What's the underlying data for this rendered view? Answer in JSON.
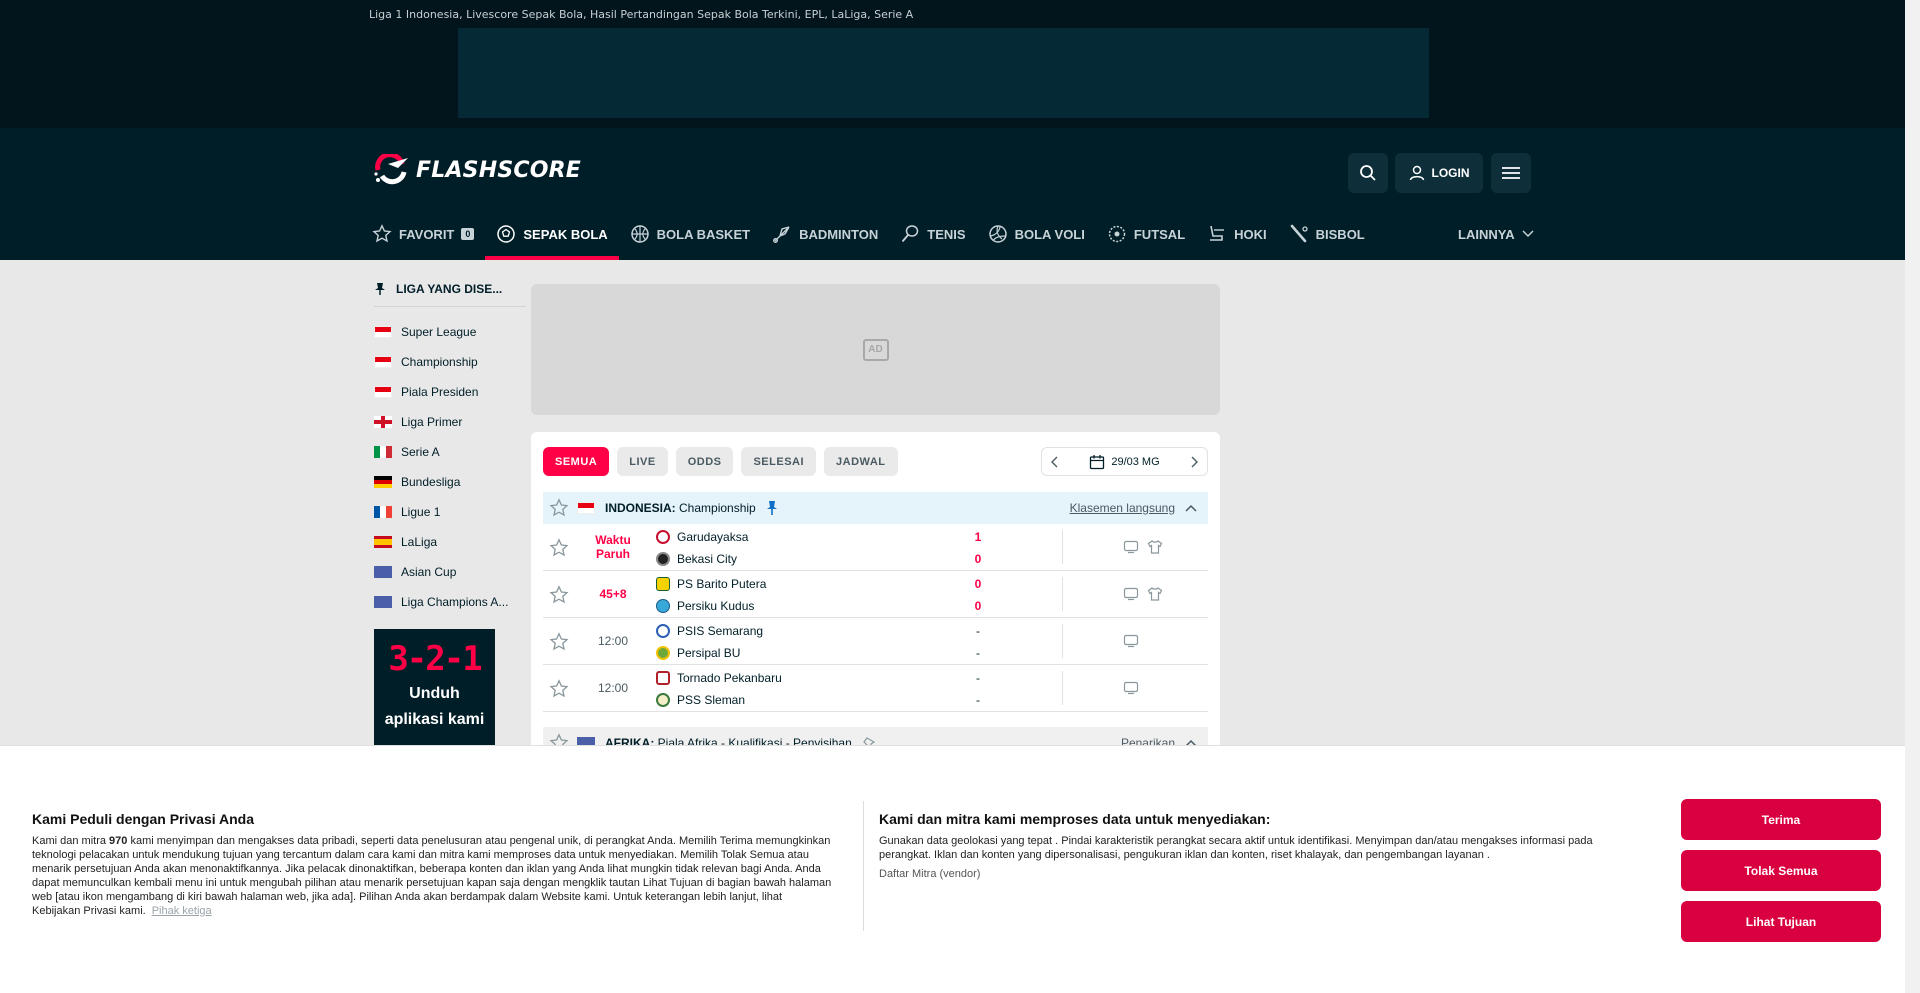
{
  "seo_title": "Liga 1 Indonesia, Livescore Sepak Bola, Hasil Pertandingan Sepak Bola Terkini, EPL, LaLiga, Serie A",
  "header": {
    "logo_text": "FLASHSCORE",
    "login_label": "LOGIN",
    "nav": [
      {
        "label": "FAVORIT",
        "icon": "star-icon",
        "badge": "0"
      },
      {
        "label": "SEPAK BOLA",
        "icon": "soccer-ball-icon"
      },
      {
        "label": "BOLA BASKET",
        "icon": "basketball-icon"
      },
      {
        "label": "BADMINTON",
        "icon": "shuttlecock-icon"
      },
      {
        "label": "TENIS",
        "icon": "tennis-racket-icon"
      },
      {
        "label": "BOLA VOLI",
        "icon": "volleyball-icon"
      },
      {
        "label": "FUTSAL",
        "icon": "futsal-ball-icon"
      },
      {
        "label": "HOKI",
        "icon": "hockey-icon"
      },
      {
        "label": "BISBOL",
        "icon": "baseball-bat-icon"
      }
    ],
    "more_label": "LAINNYA"
  },
  "sidebar": {
    "title": "LIGA YANG DISE...",
    "leagues": [
      {
        "name": "Super League",
        "flag": "indonesia"
      },
      {
        "name": "Championship",
        "flag": "indonesia"
      },
      {
        "name": "Piala Presiden",
        "flag": "indonesia"
      },
      {
        "name": "Liga Primer",
        "flag": "england"
      },
      {
        "name": "Serie A",
        "flag": "italy"
      },
      {
        "name": "Bundesliga",
        "flag": "germany"
      },
      {
        "name": "Ligue 1",
        "flag": "france"
      },
      {
        "name": "LaLiga",
        "flag": "spain"
      },
      {
        "name": "Asian Cup",
        "flag": "asia"
      },
      {
        "name": "Liga Champions A...",
        "flag": "asia"
      }
    ],
    "app_promo": {
      "big": "3-2-1",
      "line1": "Unduh",
      "line2": "aplikasi kami"
    }
  },
  "ad_label": "AD",
  "filters": [
    "SEMUA",
    "LIVE",
    "ODDS",
    "SELESAI",
    "JADWAL"
  ],
  "date_label": "29/03 MG",
  "league1": {
    "country": "INDONESIA:",
    "name": "Championship",
    "standings": "Klasemen langsung"
  },
  "matches": [
    {
      "time": "Waktu Paruh",
      "live": true,
      "home": "Garudayaksa",
      "away": "Bekasi City",
      "home_score": "1",
      "away_score": "0",
      "icons": 2
    },
    {
      "time": "45+8",
      "live": true,
      "home": "PS Barito Putera",
      "away": "Persiku Kudus",
      "home_score": "0",
      "away_score": "0",
      "icons": 2
    },
    {
      "time": "12:00",
      "live": false,
      "home": "PSIS Semarang",
      "away": "Persipal BU",
      "home_score": "-",
      "away_score": "-",
      "icons": 1
    },
    {
      "time": "12:00",
      "live": false,
      "home": "Tornado Pekanbaru",
      "away": "PSS Sleman",
      "home_score": "-",
      "away_score": "-",
      "icons": 1
    }
  ],
  "league2": {
    "country": "AFRIKA:",
    "name": "Piala Afrika - Kualifikasi - Penyisihan",
    "standings": "Penarikan"
  },
  "cookie": {
    "title": "Kami Peduli dengan Privasi Anda",
    "body_pre": "Kami dan mitra ",
    "count": "970",
    "body_post": " kami menyimpan dan mengakses data pribadi, seperti data penelusuran atau pengenal unik, di perangkat Anda. Memilih Terima memungkinkan teknologi pelacakan untuk mendukung tujuan yang tercantum dalam cara kami dan mitra kami memproses data untuk menyediakan. Memilih Tolak Semua atau menarik persetujuan Anda akan menonaktifkannya. Jika pelacak dinonaktifkan, beberapa konten dan iklan yang Anda lihat mungkin tidak relevan bagi Anda. Anda dapat memunculkan kembali menu ini untuk mengubah pilihan atau menarik persetujuan kapan saja dengan mengklik tautan Lihat Tujuan di bagian bawah halaman web [atau ikon mengambang di kiri bawah halaman web, jika ada]. Pilihan Anda akan berdampak dalam Website kami. Untuk keterangan lebih lanjut, lihat Kebijakan Privasi kami.",
    "third_party": "Pihak ketiga",
    "mid_title": "Kami dan mitra kami memproses data untuk menyediakan:",
    "mid_body": "Gunakan data geolokasi yang tepat . Pindai karakteristik perangkat secara aktif untuk identifikasi. Menyimpan dan/atau mengakses informasi pada perangkat. Iklan dan konten yang dipersonalisasi, pengukuran iklan dan konten, riset khalayak, dan pengembangan layanan .",
    "vendors": "Daftar Mitra (vendor)",
    "accept": "Terima",
    "reject": "Tolak Semua",
    "purposes": "Lihat Tujuan"
  },
  "colors": {
    "brand_red": "#ff0046",
    "header_bg": "#001e28",
    "topbar_bg": "#02141c"
  }
}
